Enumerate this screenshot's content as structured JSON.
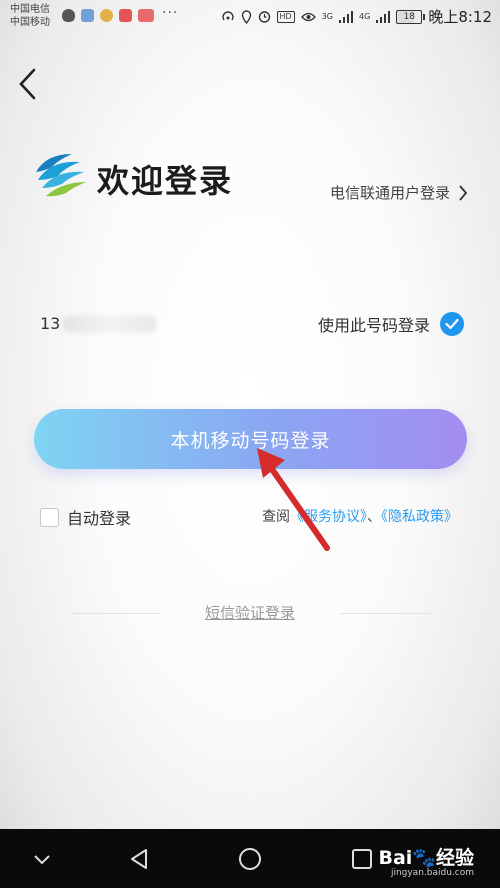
{
  "status_bar": {
    "carrier_1": "中国电信",
    "carrier_2": "中国移动",
    "dots": "···",
    "hd": "HD",
    "net_3g": "3G",
    "net_4g": "4G",
    "battery": "18",
    "time": "晚上8:12"
  },
  "header": {
    "title": "欢迎登录",
    "alt_login": "电信联通用户登录"
  },
  "phone": {
    "prefix": "13",
    "use_number_label": "使用此号码登录"
  },
  "main_button": {
    "label": "本机移动号码登录"
  },
  "options": {
    "auto_login": "自动登录",
    "agree_prefix": "查阅",
    "service_agreement": "《服务协议》",
    "separator": "、",
    "privacy_policy": "《隐私政策》"
  },
  "sms_login": "短信验证登录",
  "watermark": {
    "brand": "Bai",
    "brand_suffix": "经验",
    "url": "jingyan.baidu.com"
  },
  "colors": {
    "accent": "#1e96f0",
    "button_start": "#7fd4f3",
    "button_end": "#a48cf1",
    "annotation": "#d62b2b"
  }
}
